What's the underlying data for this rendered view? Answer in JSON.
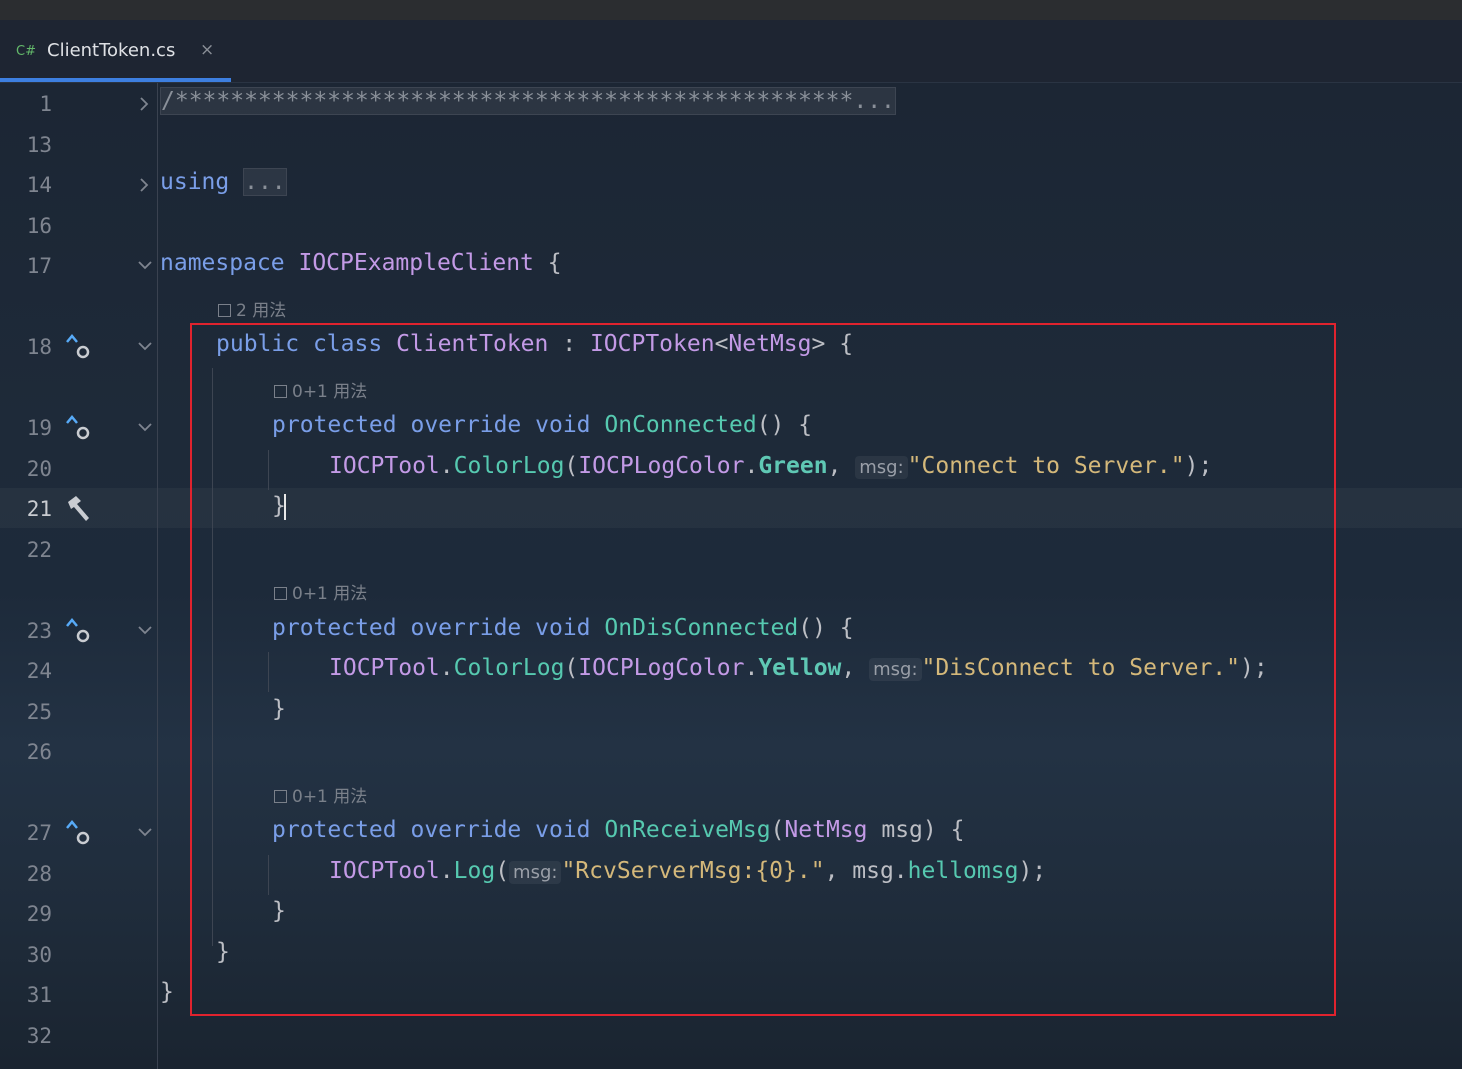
{
  "tab": {
    "lang_badge": "C#",
    "filename": "ClientToken.cs",
    "close_glyph": "×"
  },
  "line_numbers": [
    "1",
    "13",
    "14",
    "16",
    "17",
    "18",
    "19",
    "20",
    "21",
    "22",
    "23",
    "24",
    "25",
    "26",
    "27",
    "28",
    "29",
    "30",
    "31",
    "32"
  ],
  "hints": {
    "usages_2": "2 用法",
    "usages_01": "0+1 用法"
  },
  "code": {
    "l1": "/*************************************************...",
    "l14_kw": "using",
    "l14_fold": "...",
    "l17_kw": "namespace",
    "l17_name": "IOCPExampleClient",
    "l17_brace": " {",
    "l18_public": "public",
    "l18_class": "class",
    "l18_name": "ClientToken",
    "l18_colon": " : ",
    "l18_base": "IOCPToken",
    "l18_lt": "<",
    "l18_generic": "NetMsg",
    "l18_gt": "> {",
    "protected": "protected",
    "override": "override",
    "void": "void",
    "l19_fn": "OnConnected",
    "l19_rest": "() {",
    "tool": "IOCPTool",
    "dot": ".",
    "colorlog": "ColorLog",
    "paren_open": "(",
    "logcolor": "IOCPLogColor",
    "green": "Green",
    "comma": ", ",
    "msg_hint": "msg:",
    "l20_str": "\"Connect to Server.\"",
    "close_stmt": ");",
    "brace_close": "}",
    "l23_fn": "OnDisConnected",
    "l23_rest": "() {",
    "yellow": "Yellow",
    "l24_str": "\"DisConnect to Server.\"",
    "l27_fn": "OnReceiveMsg",
    "l27_type": "NetMsg",
    "l27_param": " msg) {",
    "log": "Log",
    "l28_str": "\"RcvServerMsg:{0}.\"",
    "l28_comma": ", msg.",
    "l28_field": "hellomsg",
    "l28_end": ");"
  }
}
